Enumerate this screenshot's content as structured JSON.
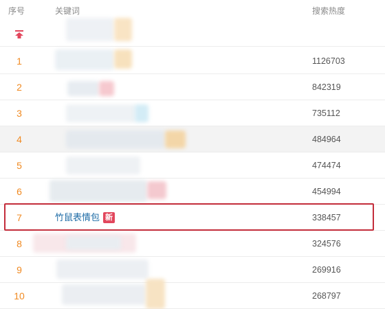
{
  "table": {
    "columns": {
      "rank": "序号",
      "keyword": "关键词",
      "heat": "搜索热度"
    },
    "rows": [
      {
        "rank": "1",
        "keyword": "",
        "heat": "1126703"
      },
      {
        "rank": "2",
        "keyword": "",
        "heat": "842319"
      },
      {
        "rank": "3",
        "keyword": "",
        "heat": "735112"
      },
      {
        "rank": "4",
        "keyword": "",
        "heat": "484964"
      },
      {
        "rank": "5",
        "keyword": "",
        "heat": "474474"
      },
      {
        "rank": "6",
        "keyword": "",
        "heat": "454994"
      },
      {
        "rank": "7",
        "keyword": "竹鼠表情包",
        "heat": "338457",
        "badge": "新"
      },
      {
        "rank": "8",
        "keyword": "",
        "heat": "324576"
      },
      {
        "rank": "9",
        "keyword": "",
        "heat": "269916"
      },
      {
        "rank": "10",
        "keyword": "",
        "heat": "268797"
      }
    ]
  },
  "icons": {
    "pinned": "arrow-up-to-top-icon"
  },
  "colors": {
    "rank": "#f08a22",
    "keyword": "#1b6aa5",
    "badge": "#e2465c",
    "highlight_border": "#c32c3a"
  }
}
